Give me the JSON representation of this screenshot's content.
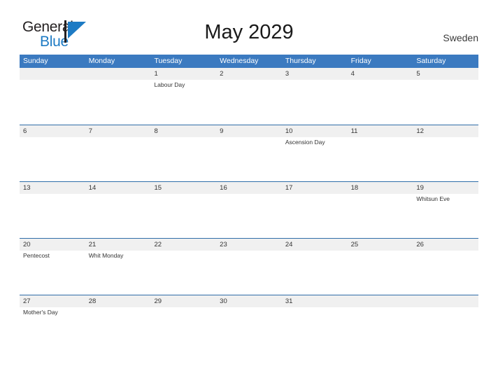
{
  "brand": {
    "name_part1": "General",
    "name_part2": "Blue",
    "flag_color": "#1e7bc4",
    "pole_color": "#231f20"
  },
  "header": {
    "title": "May 2029",
    "country": "Sweden"
  },
  "theme": {
    "header_blue": "#3b7ac0",
    "row_divider_blue": "#2f6da8",
    "band_gray": "#f0f0f0",
    "text_color": "#333333"
  },
  "calendar": {
    "weekdays": [
      "Sunday",
      "Monday",
      "Tuesday",
      "Wednesday",
      "Thursday",
      "Friday",
      "Saturday"
    ],
    "weeks": [
      [
        {
          "day": "",
          "event": ""
        },
        {
          "day": "",
          "event": ""
        },
        {
          "day": "1",
          "event": "Labour Day"
        },
        {
          "day": "2",
          "event": ""
        },
        {
          "day": "3",
          "event": ""
        },
        {
          "day": "4",
          "event": ""
        },
        {
          "day": "5",
          "event": ""
        }
      ],
      [
        {
          "day": "6",
          "event": ""
        },
        {
          "day": "7",
          "event": ""
        },
        {
          "day": "8",
          "event": ""
        },
        {
          "day": "9",
          "event": ""
        },
        {
          "day": "10",
          "event": "Ascension Day"
        },
        {
          "day": "11",
          "event": ""
        },
        {
          "day": "12",
          "event": ""
        }
      ],
      [
        {
          "day": "13",
          "event": ""
        },
        {
          "day": "14",
          "event": ""
        },
        {
          "day": "15",
          "event": ""
        },
        {
          "day": "16",
          "event": ""
        },
        {
          "day": "17",
          "event": ""
        },
        {
          "day": "18",
          "event": ""
        },
        {
          "day": "19",
          "event": "Whitsun Eve"
        }
      ],
      [
        {
          "day": "20",
          "event": "Pentecost"
        },
        {
          "day": "21",
          "event": "Whit Monday"
        },
        {
          "day": "22",
          "event": ""
        },
        {
          "day": "23",
          "event": ""
        },
        {
          "day": "24",
          "event": ""
        },
        {
          "day": "25",
          "event": ""
        },
        {
          "day": "26",
          "event": ""
        }
      ],
      [
        {
          "day": "27",
          "event": "Mother's Day"
        },
        {
          "day": "28",
          "event": ""
        },
        {
          "day": "29",
          "event": ""
        },
        {
          "day": "30",
          "event": ""
        },
        {
          "day": "31",
          "event": ""
        },
        {
          "day": "",
          "event": ""
        },
        {
          "day": "",
          "event": ""
        }
      ]
    ]
  }
}
